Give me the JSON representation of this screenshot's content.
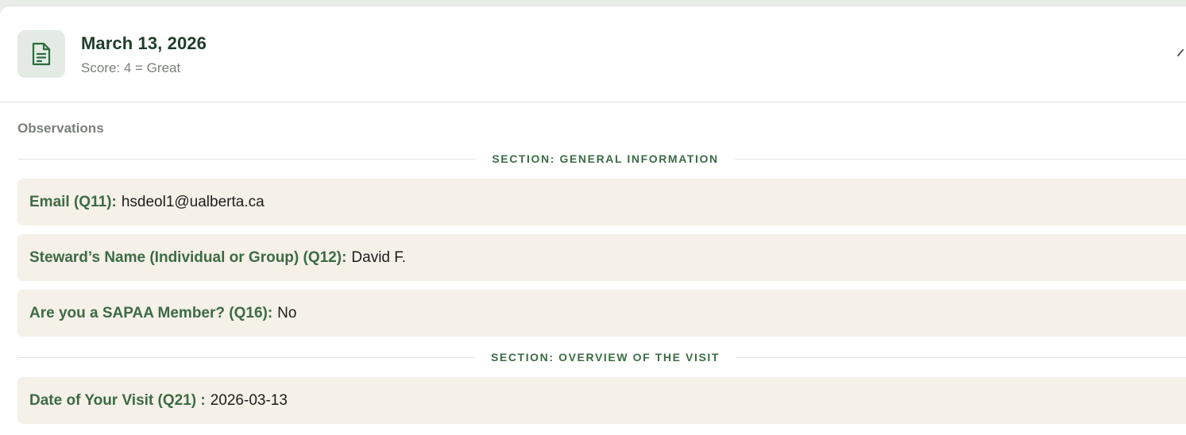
{
  "header": {
    "title": "March 13, 2026",
    "subtitle": "Score: 4 = Great",
    "icon": "document-icon",
    "collapse_icon": "chevron-up-icon"
  },
  "observations": {
    "label": "Observations",
    "sections": [
      {
        "title": "SECTION: GENERAL INFORMATION",
        "fields": [
          {
            "label": "Email (Q11):",
            "value": "hsdeol1@ualberta.ca"
          },
          {
            "label": "Steward’s Name (Individual or Group) (Q12):",
            "value": "David F."
          },
          {
            "label": "Are you a SAPAA Member? (Q16):",
            "value": "No"
          }
        ]
      },
      {
        "title": "SECTION: OVERVIEW OF THE VISIT",
        "fields": [
          {
            "label": "Date of Your Visit (Q21) :",
            "value": "2026-03-13"
          }
        ]
      }
    ]
  },
  "colors": {
    "accent_green": "#3c6b45",
    "title_dark": "#1f3d2a",
    "field_bg": "#f5f0e8",
    "icon_bg": "#e3ebe4"
  }
}
